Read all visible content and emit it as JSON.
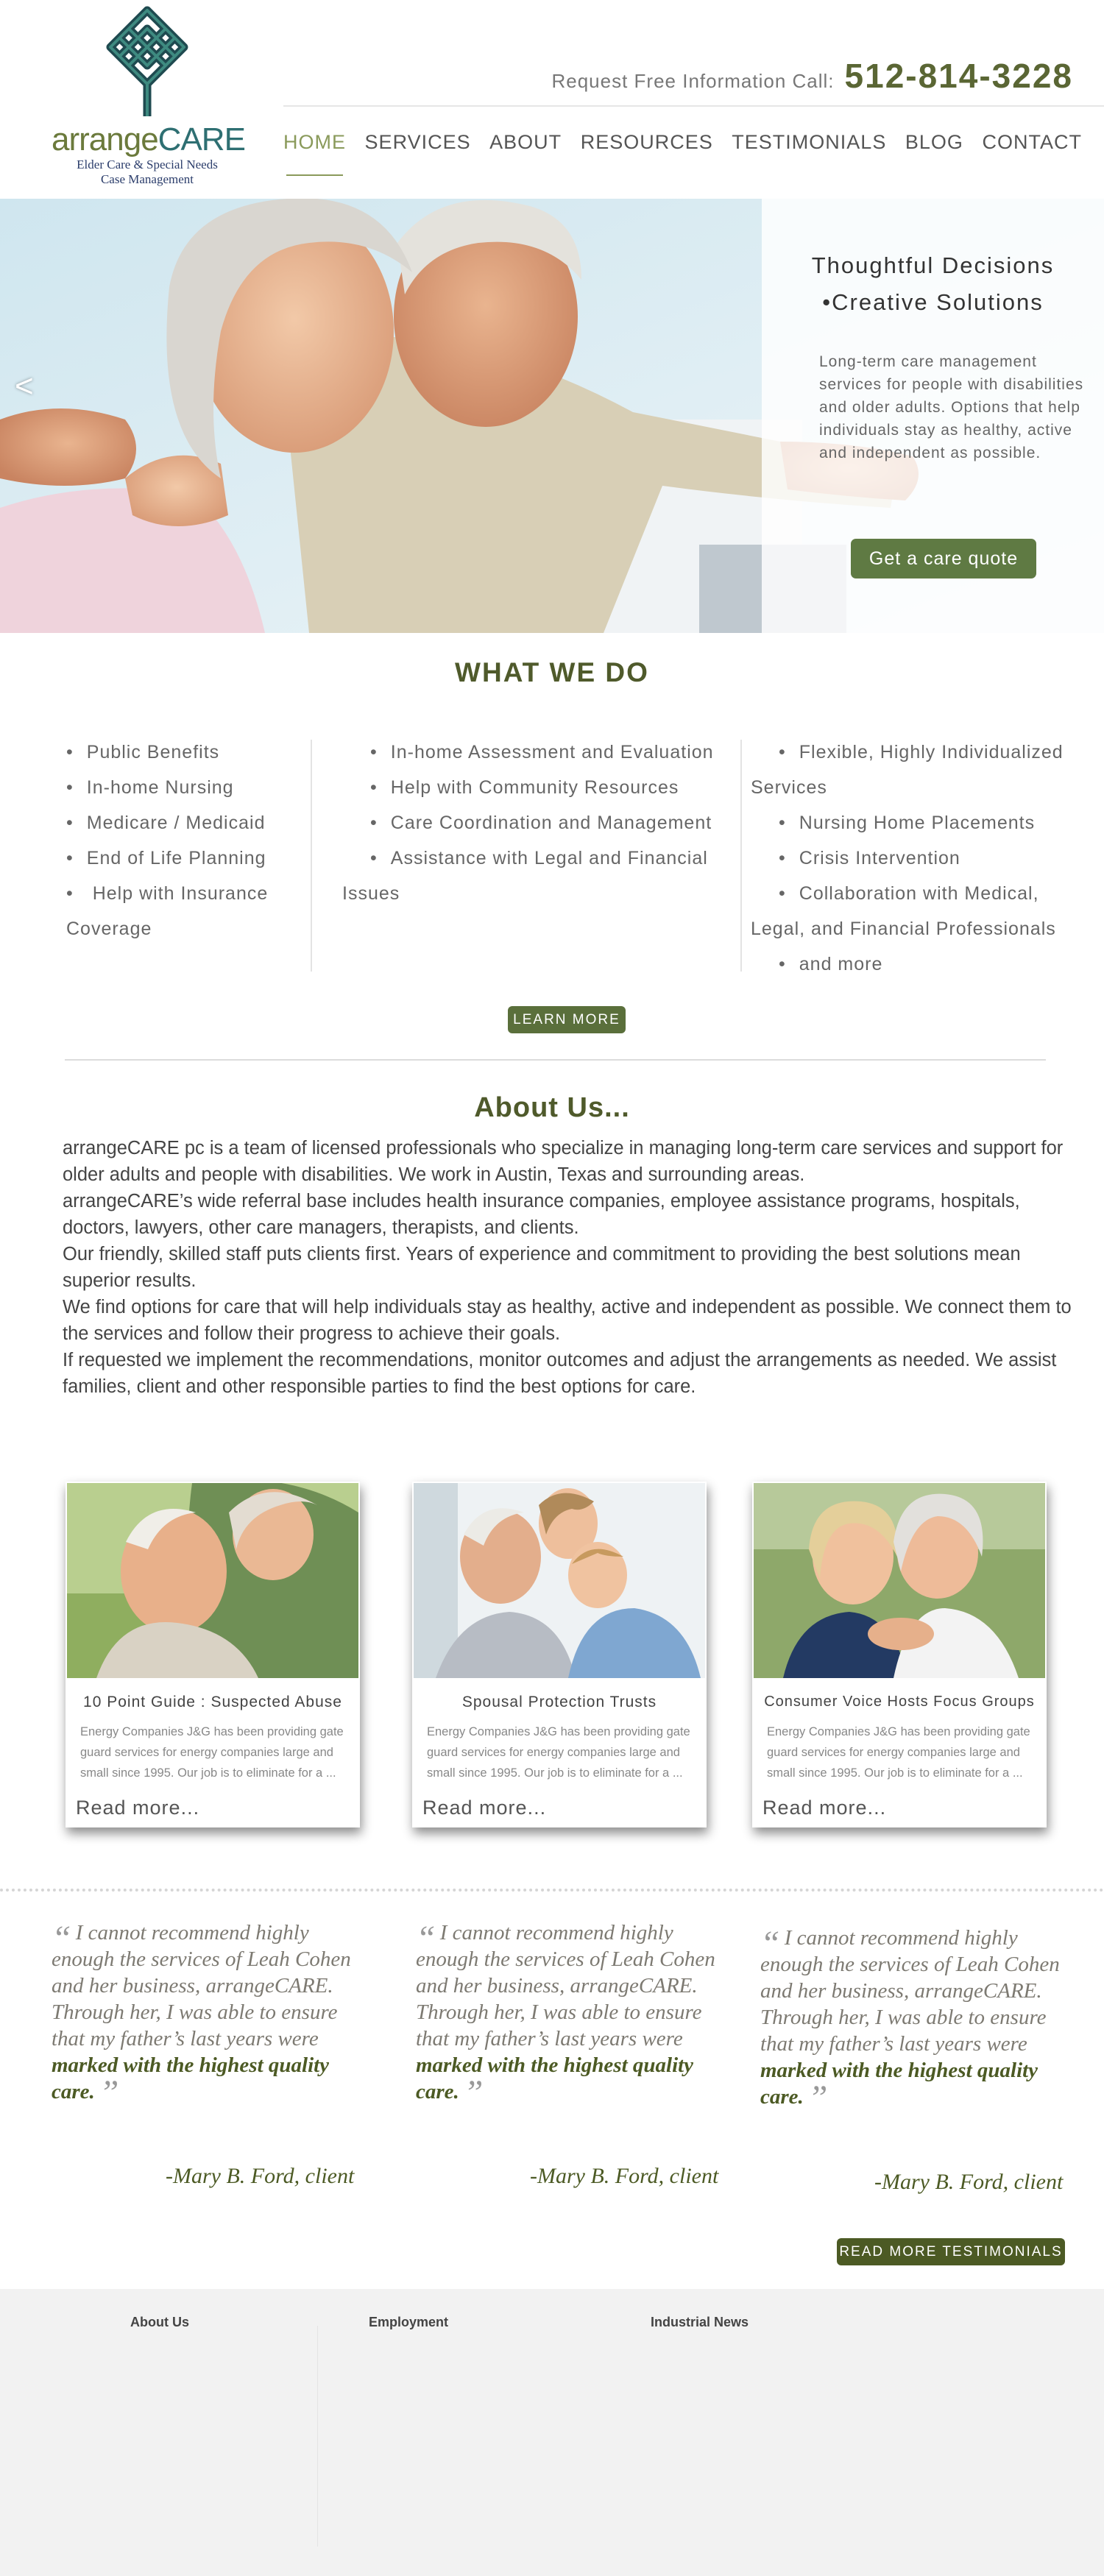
{
  "logo": {
    "name_part1": "arrange",
    "name_part2": "CARE",
    "tagline_line1": "Elder Care & Special Needs",
    "tagline_line2": "Case Management"
  },
  "header": {
    "call_label": "Request Free Information Call:",
    "phone": "512-814-3228"
  },
  "nav": {
    "items": [
      "HOME",
      "SERVICES",
      "ABOUT",
      "RESOURCES",
      "TESTIMONIALS",
      "BLOG",
      "CONTACT"
    ],
    "active": "HOME"
  },
  "hero": {
    "prev_arrow": "<",
    "heading_line1": "Thoughtful Decisions",
    "heading_line2": "•Creative Solutions",
    "text": "Long-term care management services for people with disabilities and older adults. Options that help individuals stay as healthy, active and independent as possible.",
    "button": "Get a care quote"
  },
  "what_we_do": {
    "title": "WHAT WE DO",
    "col1": [
      "Public Benefits",
      "In-home Nursing",
      "Medicare / Medicaid",
      "End of Life Planning",
      " Help with Insurance Coverage"
    ],
    "col2": [
      "In-home Assessment and Evaluation",
      "Help with Community Resources",
      "Care Coordination and Management",
      "Assistance with Legal and Financial Issues"
    ],
    "col3": [
      "Flexible, Highly Individualized Services",
      "Nursing Home Placements",
      "Crisis Intervention",
      "Collaboration with Medical, Legal, and Financial Professionals",
      "and more"
    ],
    "button": "LEARN MORE"
  },
  "about": {
    "title": "About Us...",
    "paragraphs": [
      "arrangeCARE pc is a team of licensed professionals who specialize in managing long-term care services and support for older adults and people with disabilities. We work in Austin, Texas and surrounding areas.",
      "arrangeCARE’s wide referral base includes health insurance companies, employee assistance programs, hospitals, doctors, lawyers, other care managers, therapists, and clients.",
      "Our friendly, skilled staff puts clients first. Years of experience and commitment to providing the best solutions mean superior results.",
      "We find options for care that will help individuals stay as healthy, active and independent as possible. We connect them to the services and follow their progress to achieve their goals.",
      "If requested we implement the recommendations, monitor outcomes and adjust the arrangements as needed. We assist families, client and other responsible parties to find the best options for care."
    ]
  },
  "cards": [
    {
      "title": "10 Point Guide : Suspected Abuse",
      "text": "Energy Companies J&G has been providing gate guard services for energy companies large and small since 1995. Our job is to eliminate  for a ...",
      "more": "Read more..."
    },
    {
      "title": "Spousal Protection Trusts",
      "text": "Energy Companies J&G has been providing gate guard services for energy companies large and small since 1995. Our job is to eliminate  for a ...",
      "more": "Read more..."
    },
    {
      "title": "Consumer Voice Hosts Focus Groups",
      "text": "Energy Companies J&G has been providing gate guard services for energy companies large and small since 1995. Our job is to eliminate  for a ...",
      "more": "Read more..."
    }
  ],
  "testimonials": {
    "open_mark": "“",
    "close_mark": "”",
    "items": [
      {
        "text": "I cannot recommend highly enough the services of Leah Cohen and her business, arrangeCARE. Through her, I was able to ensure that my father’s last years were ",
        "highlight": "marked with the highest quality care.",
        "author": "-Mary B. Ford, client"
      },
      {
        "text": "I cannot recommend highly enough the services of Leah Cohen and her business, arrangeCARE. Through her, I was able to ensure that my father’s last years were ",
        "highlight": "marked with the highest quality care.",
        "author": "-Mary B. Ford, client"
      },
      {
        "text": "I cannot recommend highly enough the services of Leah Cohen and her business, arrangeCARE. Through her, I was able to ensure that my father’s last years were ",
        "highlight": "marked with the highest quality care.",
        "author": "-Mary B. Ford, client"
      }
    ],
    "button": "READ MORE TESTIMONIALS"
  },
  "footer": {
    "headings": [
      "About Us",
      "Employment",
      "Industrial News"
    ]
  },
  "colors": {
    "olive_dark": "#4c5a24",
    "olive_button": "#5f7a43",
    "nav_active": "#8a9a5b",
    "logo_teal": "#2e6f72"
  }
}
